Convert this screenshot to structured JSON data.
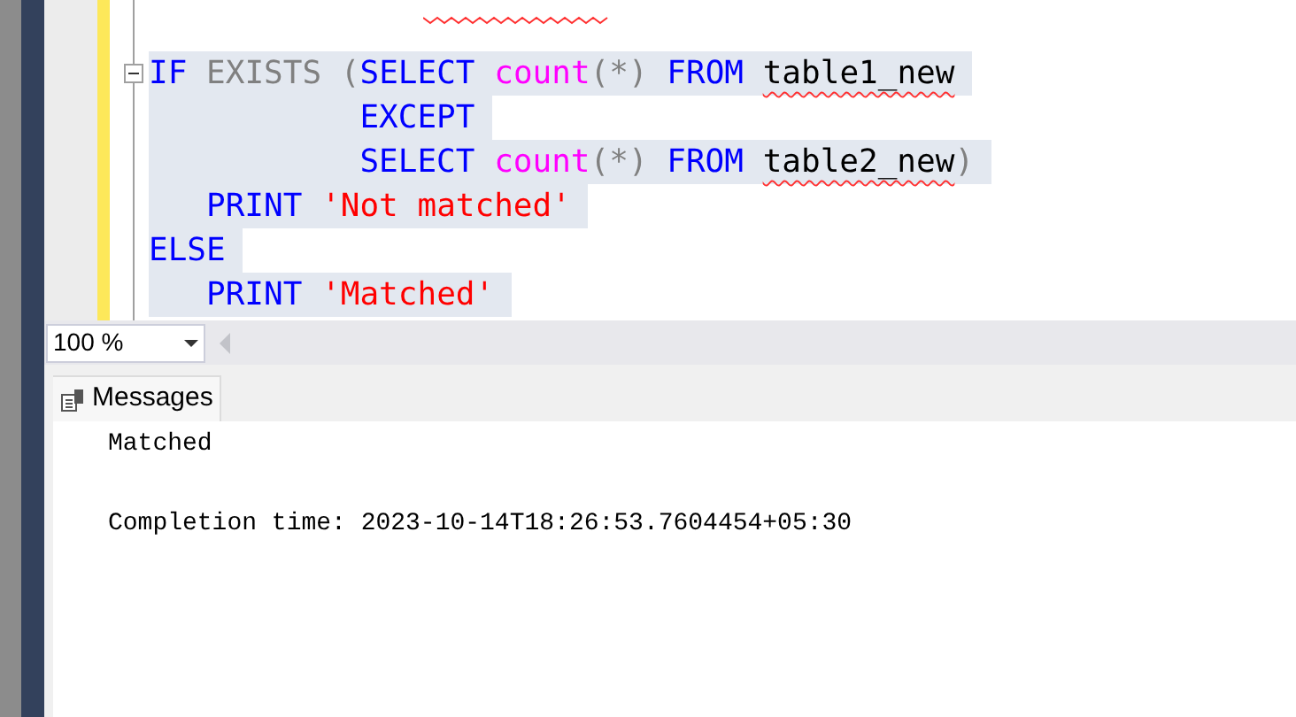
{
  "editor": {
    "lines": [
      {
        "selected": true,
        "fold": true,
        "tokens": [
          {
            "kind": "keyword",
            "text": "IF"
          },
          {
            "kind": "operator",
            "text": " EXISTS ("
          },
          {
            "kind": "keyword",
            "text": "SELECT"
          },
          {
            "kind": "function",
            "text": " count"
          },
          {
            "kind": "operator",
            "text": "(*)"
          },
          {
            "kind": "keyword",
            "text": " FROM "
          },
          {
            "kind": "identifier",
            "text": "table1_new"
          }
        ]
      },
      {
        "selected": true,
        "fold": false,
        "tokens": [
          {
            "kind": "keyword",
            "text": "           EXCEPT"
          }
        ]
      },
      {
        "selected": true,
        "fold": false,
        "tokens": [
          {
            "kind": "keyword",
            "text": "           SELECT"
          },
          {
            "kind": "function",
            "text": " count"
          },
          {
            "kind": "operator",
            "text": "(*)"
          },
          {
            "kind": "keyword",
            "text": " FROM "
          },
          {
            "kind": "identifier",
            "text": "table2_new"
          },
          {
            "kind": "operator",
            "text": ")"
          }
        ]
      },
      {
        "selected": true,
        "fold": false,
        "tokens": [
          {
            "kind": "keyword",
            "text": "   PRINT "
          },
          {
            "kind": "string",
            "text": "'Not matched'"
          }
        ]
      },
      {
        "selected": true,
        "fold": false,
        "tokens": [
          {
            "kind": "keyword",
            "text": "ELSE"
          }
        ]
      },
      {
        "selected": true,
        "fold": false,
        "tokens": [
          {
            "kind": "keyword",
            "text": "   PRINT "
          },
          {
            "kind": "string",
            "text": "'Matched'"
          }
        ]
      }
    ]
  },
  "zoom": {
    "value": "100 %"
  },
  "results": {
    "tabs": [
      {
        "label": "Messages",
        "selected": true
      }
    ],
    "messages": [
      "Matched",
      "Completion time: 2023-10-14T18:26:53.7604454+05:30"
    ]
  }
}
